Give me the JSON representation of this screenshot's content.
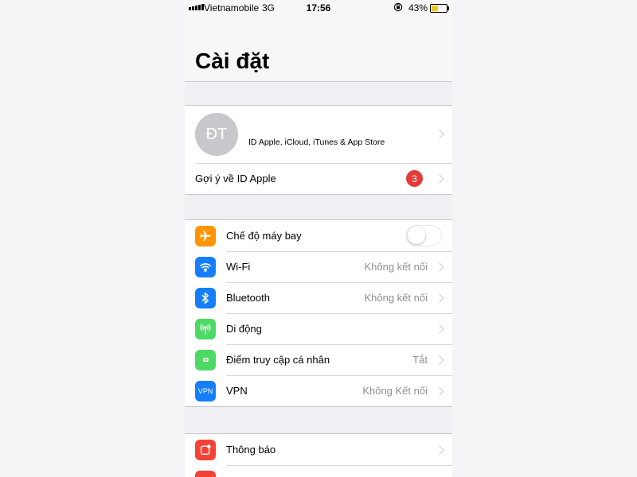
{
  "status_bar": {
    "carrier": "Vietnamobile",
    "network": "3G",
    "time": "17:56",
    "battery_percent": "43%",
    "battery_level": 0.43
  },
  "header": {
    "title": "Cài đặt"
  },
  "profile": {
    "initials": "ĐT",
    "name": "",
    "subtitle": "ID Apple, iCloud, iTunes & App Store",
    "suggestion_label": "Gợi ý về ID Apple",
    "suggestion_badge": "3"
  },
  "connectivity": {
    "items": [
      {
        "label": "Chế độ máy bay",
        "value": "",
        "icon": "airplane-icon",
        "color": "#ff9500",
        "toggle": false
      },
      {
        "label": "Wi-Fi",
        "value": "Không kết nối",
        "icon": "wifi-icon",
        "color": "#157efb"
      },
      {
        "label": "Bluetooth",
        "value": "Không kết nối",
        "icon": "bluetooth-icon",
        "color": "#157efb"
      },
      {
        "label": "Di động",
        "value": "",
        "icon": "cellular-icon",
        "color": "#4cd964"
      },
      {
        "label": "Điểm truy cập cá nhân",
        "value": "Tắt",
        "icon": "hotspot-icon",
        "color": "#4cd964"
      },
      {
        "label": "VPN",
        "value": "Không Kết nối",
        "icon": "vpn-icon",
        "color": "#157efb",
        "icon_text": "VPN"
      }
    ]
  },
  "notifications": {
    "items": [
      {
        "label": "Thông báo",
        "value": "",
        "icon": "notifications-icon",
        "color": "#f44336"
      }
    ]
  }
}
